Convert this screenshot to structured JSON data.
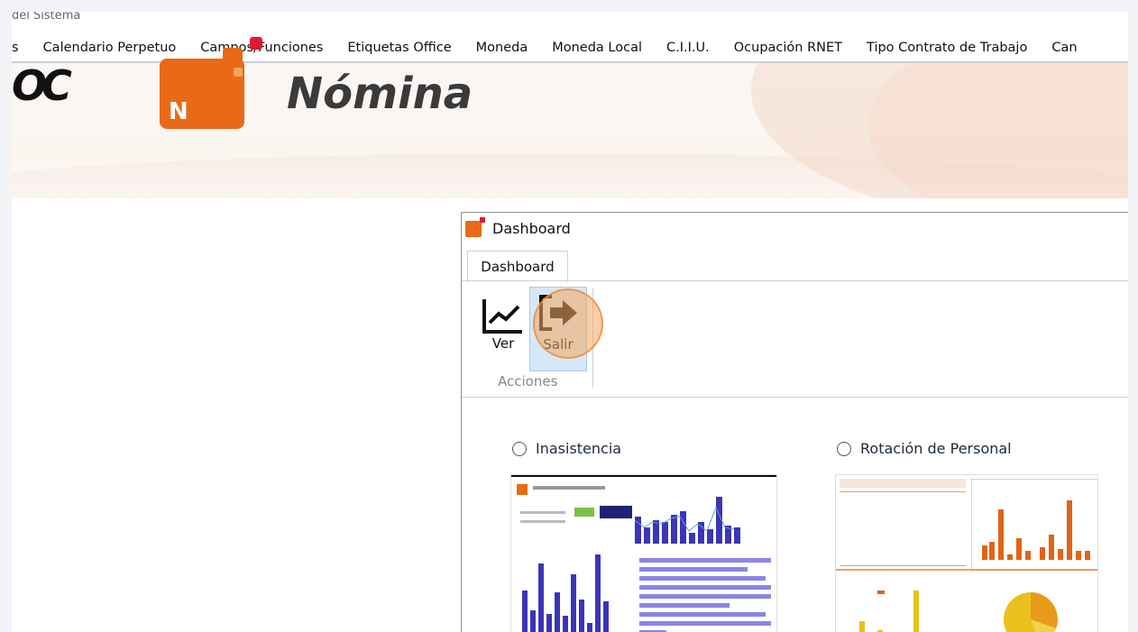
{
  "window": {
    "title_fragment": "del Sistema"
  },
  "menu": {
    "items": [
      "s",
      "Calendario Perpetuo",
      "Campos/Funciones",
      "Etiquetas Office",
      "Moneda",
      "Moneda Local",
      "C.I.I.U.",
      "Ocupación RNET",
      "Tipo Contrato de Trabajo",
      "Can"
    ]
  },
  "banner": {
    "brand": "Nómina",
    "badge_letter": "N",
    "left_logo": "OC"
  },
  "dialog": {
    "title": "Dashboard",
    "tab": "Dashboard",
    "ribbon": {
      "ver_label": "Ver",
      "salir_label": "Salir",
      "group_label": "Acciones"
    },
    "options": [
      {
        "label": "Inasistencia"
      },
      {
        "label": "Rotación de Personal"
      }
    ]
  },
  "colors": {
    "accent": "#e86a16",
    "chart_blue": "#3b35b8",
    "chart_orange": "#e06418",
    "chart_yellow": "#e8c21a"
  }
}
